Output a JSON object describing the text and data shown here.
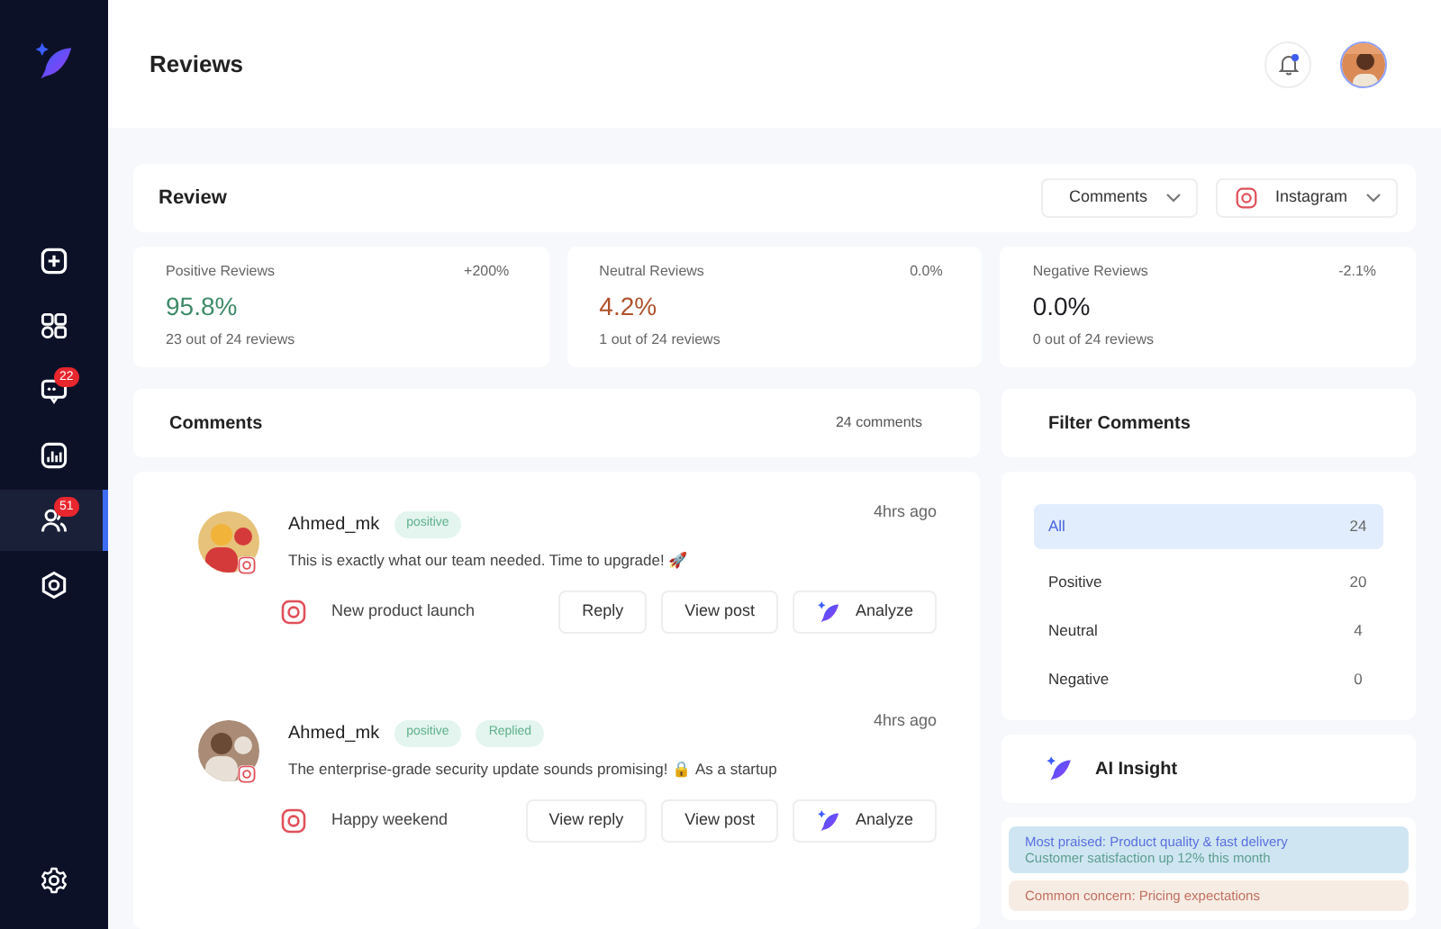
{
  "sidebar": {
    "items": [
      {
        "kind": "add",
        "selected": false
      },
      {
        "kind": "grid",
        "selected": false
      },
      {
        "kind": "chat",
        "selected": false,
        "badge": "22"
      },
      {
        "kind": "chart",
        "selected": false
      },
      {
        "kind": "users",
        "selected": true,
        "badge": "51"
      },
      {
        "kind": "hex",
        "selected": false
      }
    ],
    "bottom": {
      "kind": "gear"
    }
  },
  "header": {
    "title": "Reviews",
    "notification": true
  },
  "review": {
    "title": "Review",
    "filters": [
      {
        "label": "Comments",
        "kind": "plain"
      },
      {
        "label": "Instagram",
        "kind": "instagram"
      }
    ]
  },
  "stats": [
    {
      "label": "Positive Reviews",
      "change": "+200%",
      "value": "95.8%",
      "color": "#3d8a68",
      "detail": "23 out of 24 reviews"
    },
    {
      "label": "Neutral Reviews",
      "change": "0.0%",
      "value": "4.2%",
      "color": "#b0522c",
      "detail": "1 out of 24 reviews"
    },
    {
      "label": "Negative Reviews",
      "change": "-2.1%",
      "value": "0.0%",
      "color": "#1d1d22",
      "detail": "0 out of 24 reviews"
    }
  ],
  "comments": {
    "title": "Comments",
    "count": "24 comments",
    "items": [
      {
        "author": "Ahmed_mk",
        "tags": [
          "positive"
        ],
        "time": "4hrs ago",
        "text": "This is exactly what our team needed. Time to upgrade! 🚀",
        "post": "New product launch",
        "buttons": [
          "Reply",
          "View post",
          "Analyze"
        ]
      },
      {
        "author": "Ahmed_mk",
        "tags": [
          "positive",
          "Replied"
        ],
        "time": "4hrs ago",
        "text": "The enterprise-grade security update sounds promising! 🔒 As a startup",
        "post": "Happy weekend",
        "buttons": [
          "View reply",
          "View post",
          "Analyze"
        ]
      }
    ]
  },
  "filter_comments": {
    "title": "Filter Comments",
    "items": [
      {
        "label": "All",
        "count": "24",
        "selected": true
      },
      {
        "label": "Positive",
        "count": "20",
        "selected": false
      },
      {
        "label": "Neutral",
        "count": "4",
        "selected": false
      },
      {
        "label": "Negative",
        "count": "0",
        "selected": false
      }
    ]
  },
  "ai_insight": {
    "title": "AI Insight",
    "items": [
      {
        "lines": [
          "Most praised: Product quality & fast delivery",
          "Customer satisfaction up 12% this month"
        ],
        "color": "#cfe6f2"
      },
      {
        "lines": [
          "Common concern: Pricing expectations"
        ],
        "color": "#f7ece4"
      }
    ]
  }
}
